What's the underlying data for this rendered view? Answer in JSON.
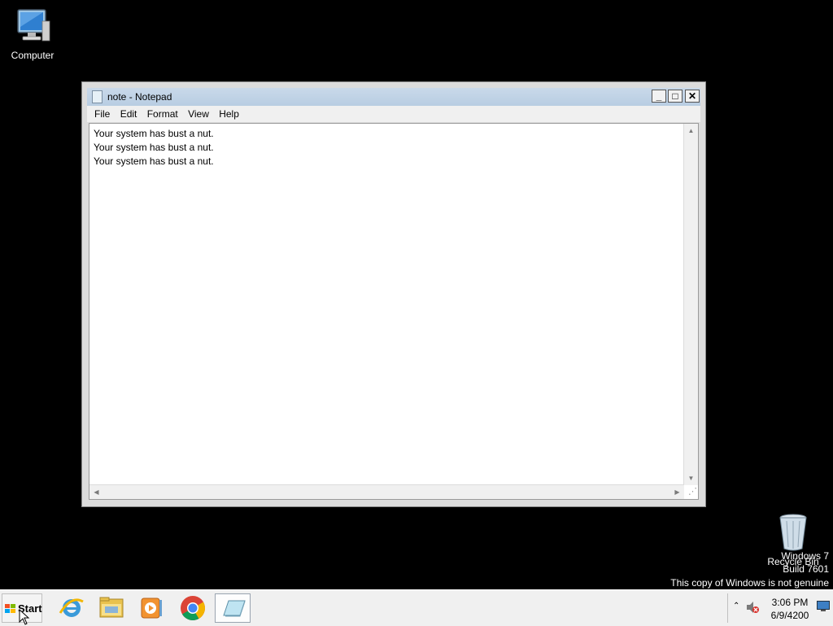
{
  "desktop": {
    "icons": [
      {
        "label": "Computer"
      },
      {
        "label": "Recycle Bin"
      }
    ],
    "watermark": {
      "line1": "Windows 7",
      "line2": "Build 7601",
      "line3": "This copy of Windows is not genuine"
    }
  },
  "window": {
    "title": "note - Notepad",
    "controls": {
      "minimize": "_",
      "maximize": "□",
      "close": "✕"
    },
    "menu": [
      "File",
      "Edit",
      "Format",
      "View",
      "Help"
    ],
    "content_lines": [
      "Your system has bust a nut.",
      "Your system has bust a nut.",
      "Your system has bust a nut."
    ]
  },
  "taskbar": {
    "start_label": "Start",
    "apps": [
      {
        "icon": "internet-explorer-icon"
      },
      {
        "icon": "folder-icon"
      },
      {
        "icon": "media-player-icon"
      },
      {
        "icon": "chrome-icon"
      },
      {
        "icon": "notepad-icon",
        "active": true
      }
    ],
    "clock": {
      "time": "3:06 PM",
      "date": "6/9/4200"
    }
  }
}
